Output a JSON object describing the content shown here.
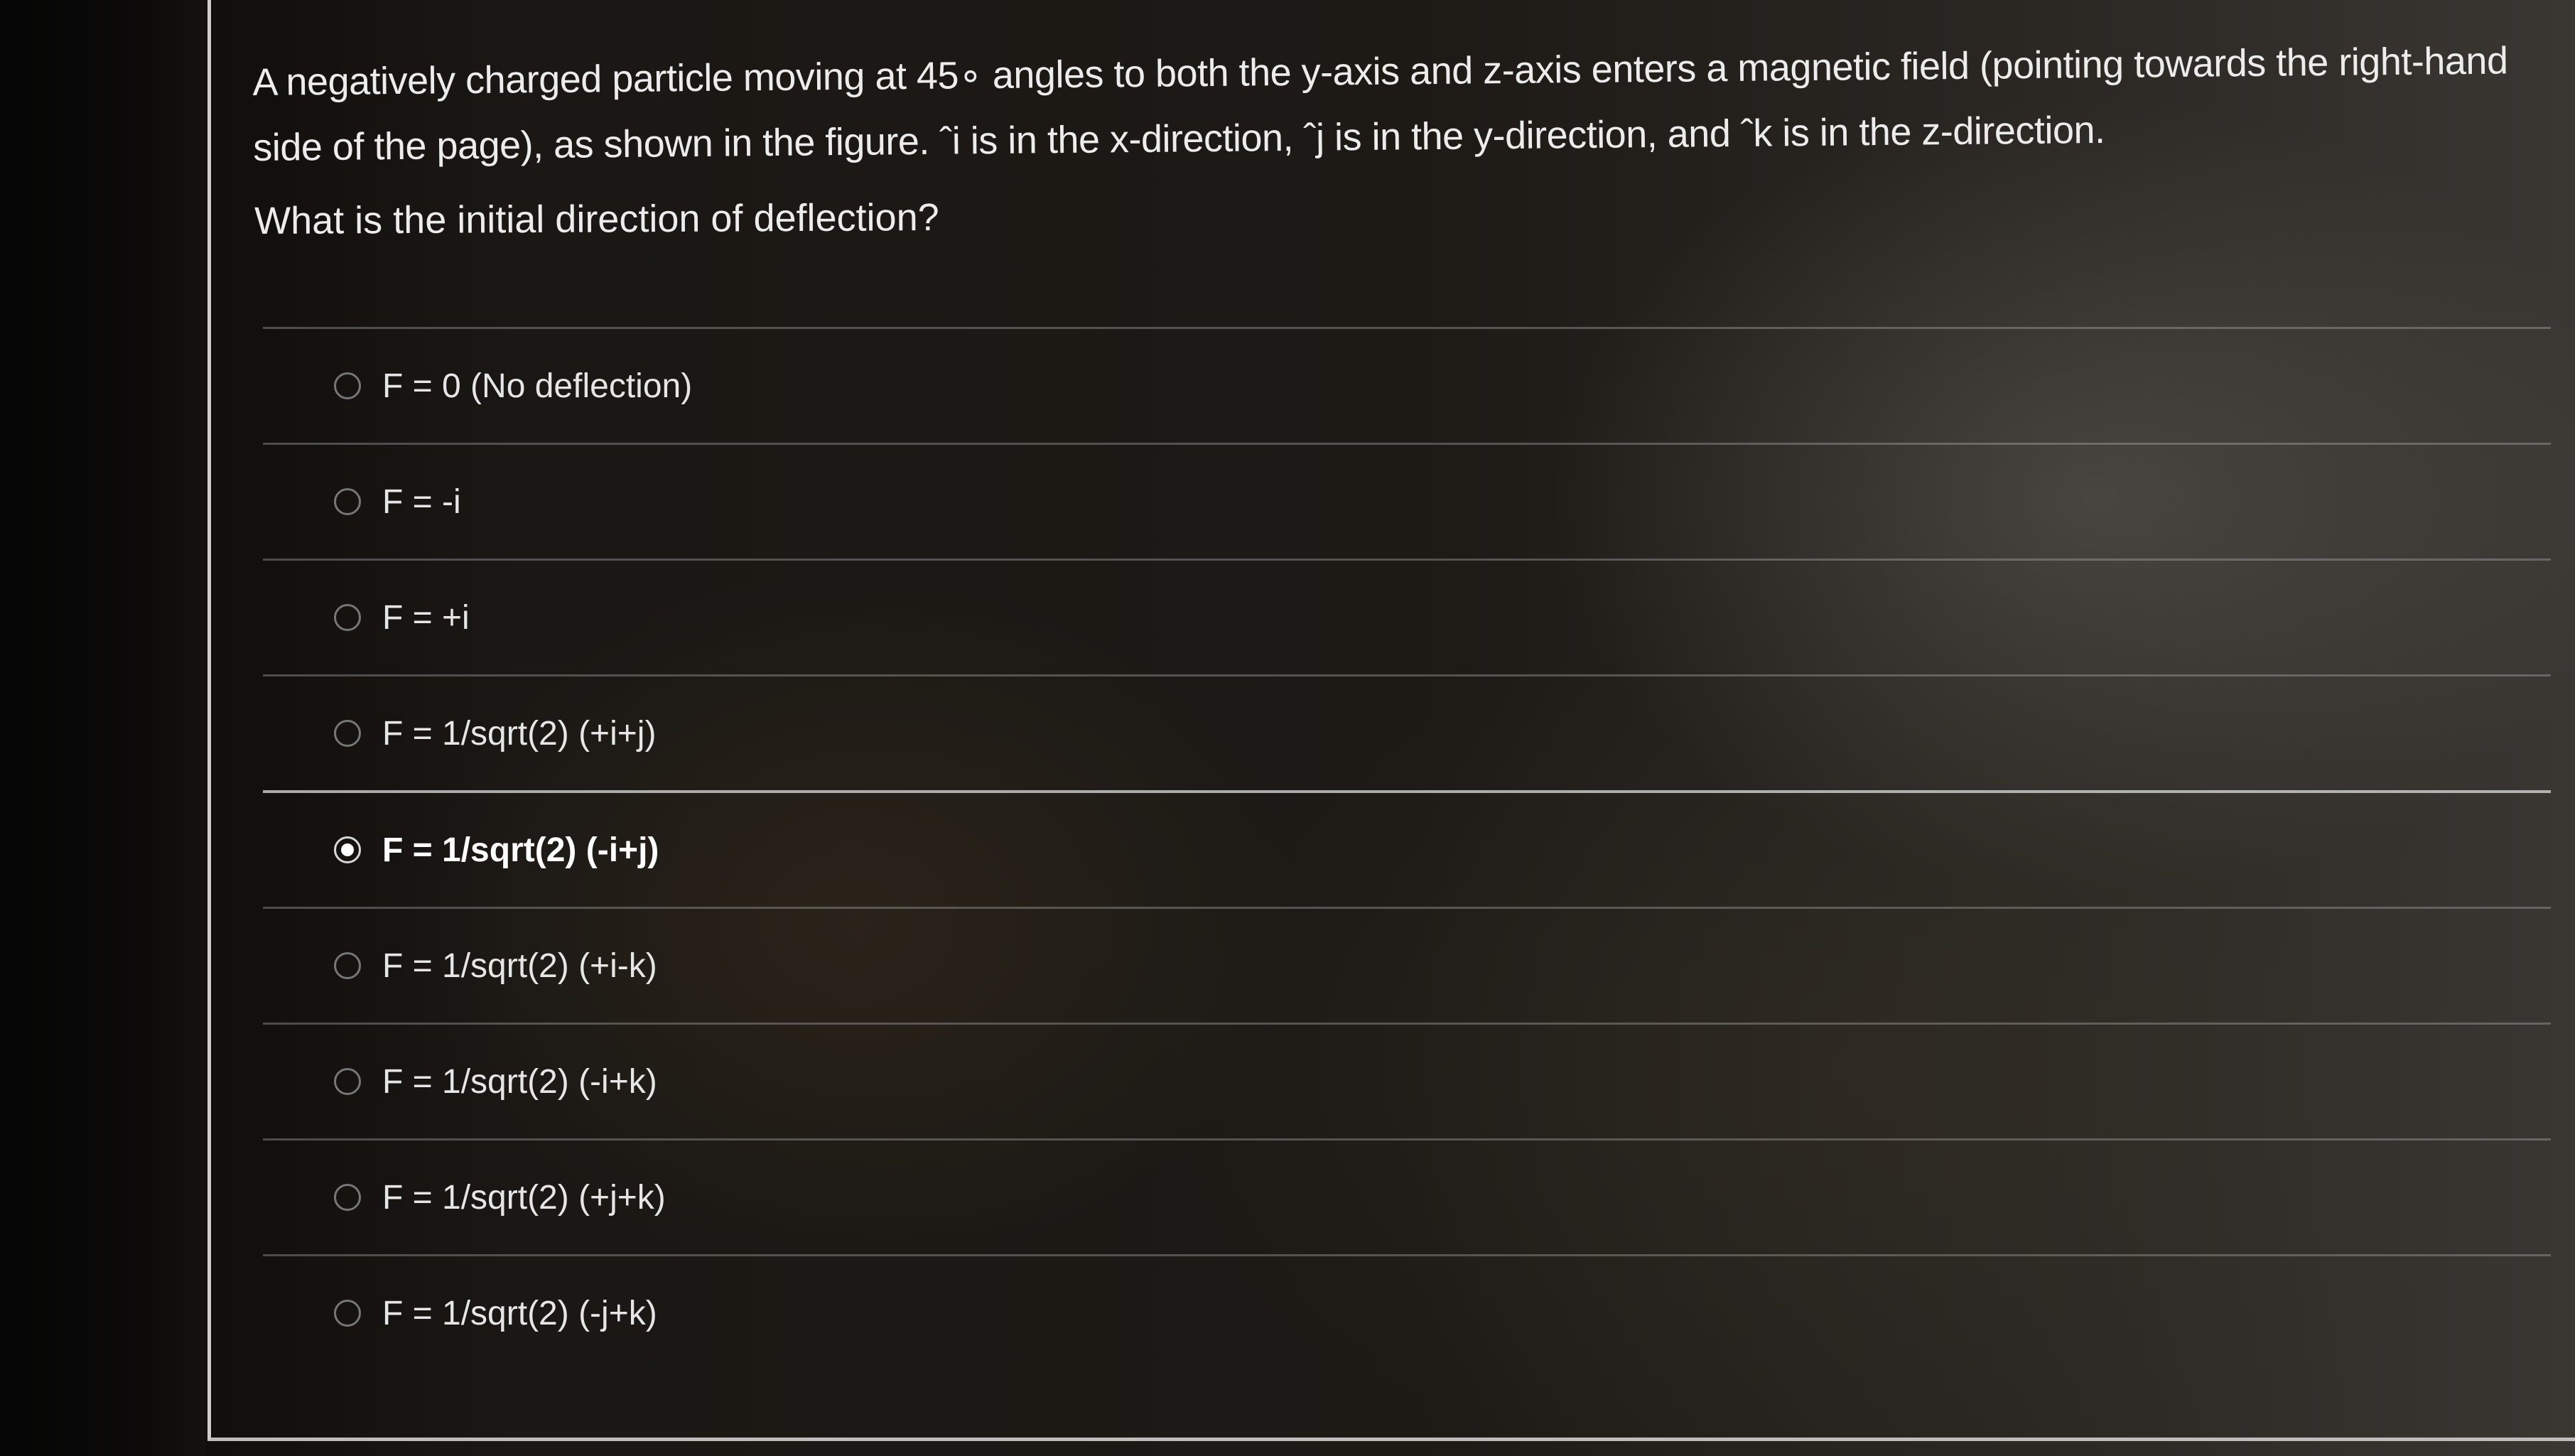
{
  "question": {
    "text": "A negatively charged particle moving at 45∘ angles to both the y-axis and z-axis enters a magnetic field (pointing towards the right-hand side of the page), as shown in the figure. ˆi is in the x-direction, ˆj is in the y-direction, and ˆk is in the z-direction.",
    "prompt": "What is the initial direction of deflection?"
  },
  "options": [
    {
      "label": "F = 0 (No deflection)",
      "selected": false
    },
    {
      "label": "F = -i",
      "selected": false
    },
    {
      "label": "F = +i",
      "selected": false
    },
    {
      "label": "F = 1/sqrt(2) (+i+j)",
      "selected": false
    },
    {
      "label": "F = 1/sqrt(2) (-i+j)",
      "selected": true
    },
    {
      "label": "F = 1/sqrt(2) (+i-k)",
      "selected": false
    },
    {
      "label": "F = 1/sqrt(2) (-i+k)",
      "selected": false
    },
    {
      "label": "F = 1/sqrt(2) (+j+k)",
      "selected": false
    },
    {
      "label": "F = 1/sqrt(2) (-j+k)",
      "selected": false
    }
  ]
}
